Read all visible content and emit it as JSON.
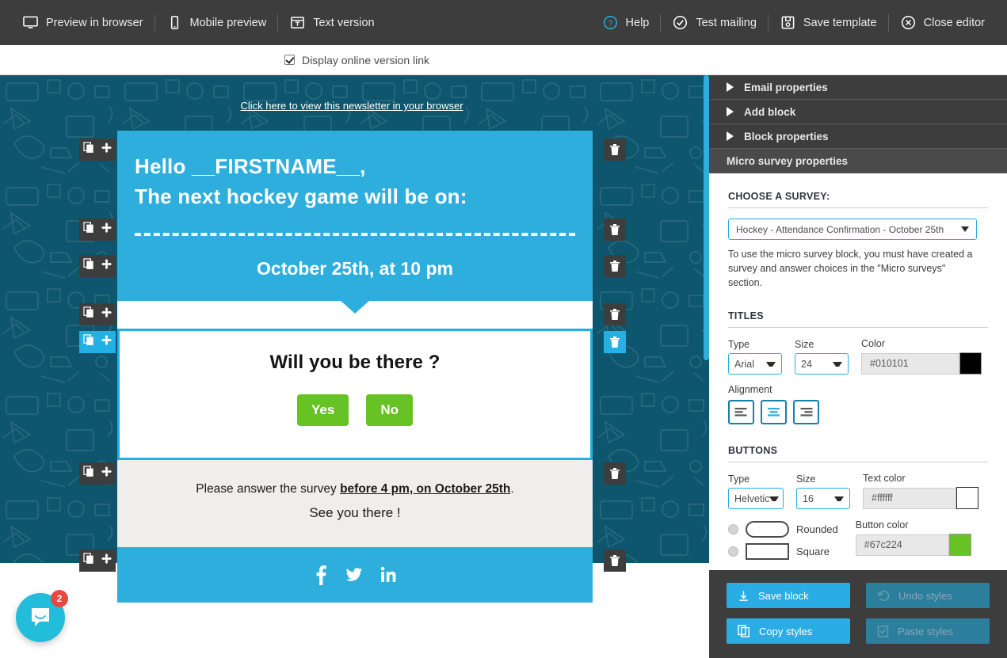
{
  "topbar": {
    "left_items": [
      {
        "label": "Preview in browser",
        "icon": "monitor-icon"
      },
      {
        "label": "Mobile preview",
        "icon": "mobile-icon"
      },
      {
        "label": "Text version",
        "icon": "text-version-icon"
      }
    ],
    "right_items": [
      {
        "label": "Help",
        "icon": "help-circle-icon"
      },
      {
        "label": "Test mailing",
        "icon": "check-circle-icon"
      },
      {
        "label": "Save template",
        "icon": "floppy-disk-icon"
      },
      {
        "label": "Close editor",
        "icon": "close-circle-icon"
      }
    ]
  },
  "subbar": {
    "checkbox_label": "Display online version link",
    "checked": true
  },
  "email": {
    "browser_link": "Click here to view this newsletter in your browser",
    "greeting": "Hello __FIRSTNAME__,",
    "subtitle": "The next hockey game will be on:",
    "date_line": "October 25th, at 10 pm",
    "survey_question": "Will you be there ?",
    "survey_buttons": [
      "Yes",
      "No"
    ],
    "note_line1_a": "Please answer the survey ",
    "note_line1_b": "before 4 pm, on October 25th",
    "note_line1_c": ".",
    "note_line2": "See you there !",
    "social": [
      "facebook-icon",
      "twitter-icon",
      "linkedin-icon"
    ],
    "header_color": "#2eaedd",
    "button_color": "#67c224",
    "note_bg": "#efeeec"
  },
  "chat": {
    "badge": "2",
    "icon": "chat-bubble-icon"
  },
  "sidebar": {
    "accordion": [
      {
        "label": "Email properties",
        "expanded": false
      },
      {
        "label": "Add block",
        "expanded": false
      },
      {
        "label": "Block properties",
        "expanded": false
      },
      {
        "label": "Micro survey properties",
        "expanded": true
      }
    ],
    "survey_section": {
      "title": "CHOOSE A SURVEY:",
      "selected": "Hockey - Attendance Confirmation - October 25th",
      "help": "To use the micro survey block, you must have created a survey and answer choices in the \"Micro surveys\" section."
    },
    "titles_section": {
      "title": "TITLES",
      "type_label": "Type",
      "type_value": "Arial",
      "size_label": "Size",
      "size_value": "24",
      "color_label": "Color",
      "color_value": "#010101",
      "alignment_label": "Alignment",
      "alignment_selected": "center"
    },
    "buttons_section": {
      "title": "BUTTONS",
      "type_label": "Type",
      "type_value": "Helvetic",
      "size_label": "Size",
      "size_value": "16",
      "text_color_label": "Text color",
      "text_color_value": "#ffffff",
      "button_color_label": "Button color",
      "button_color_value": "#67c224",
      "shape_rounded": "Rounded",
      "shape_square": "Square"
    },
    "actions": [
      {
        "label": "Save block",
        "icon": "download-icon",
        "disabled": false
      },
      {
        "label": "Undo styles",
        "icon": "undo-icon",
        "disabled": true
      },
      {
        "label": "Copy styles",
        "icon": "copy-icon",
        "disabled": false
      },
      {
        "label": "Paste styles",
        "icon": "paste-icon",
        "disabled": true
      }
    ]
  }
}
